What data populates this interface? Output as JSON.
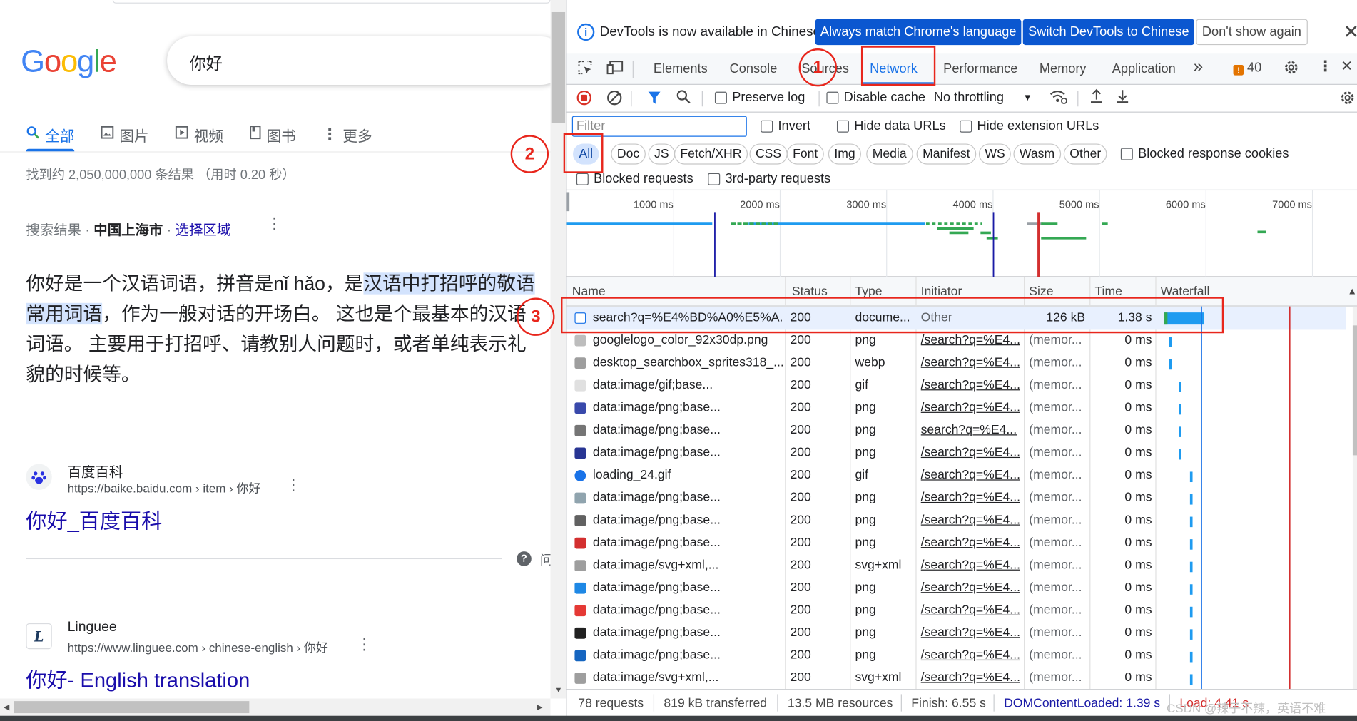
{
  "google": {
    "logo": "Google",
    "search_value": "你好",
    "tabs": [
      {
        "icon": "search-icon",
        "label": "全部",
        "active": true
      },
      {
        "icon": "image-icon",
        "label": "图片"
      },
      {
        "icon": "video-icon",
        "label": "视频"
      },
      {
        "icon": "book-icon",
        "label": "图书"
      },
      {
        "icon": "more-dots-icon",
        "label": "更多"
      }
    ],
    "stats": "找到约 2,050,000,000 条结果 （用时 0.20 秒）",
    "location_prefix": "搜索结果 · ",
    "location_city": "中国上海市",
    "location_sep": " · ",
    "location_link": "选择区域",
    "snippet_a": "你好是一个汉语词语，拼音是nǐ hǎo，是",
    "snippet_hl": "汉语中打招呼的敬语常用词语",
    "snippet_b": "，作为一般对话的开场白。 这也是个最基本的汉语词语。 主要用于打招呼、请教别人问题时，或者单纯表示礼貌的时候等。",
    "results": [
      {
        "site": "百度百科",
        "url": "https://baike.baidu.com › item › 你好",
        "title": "你好_百度百科"
      },
      {
        "site": "Linguee",
        "url": "https://www.linguee.com › chinese-english › 你好",
        "title": "你好- English translation"
      }
    ],
    "help_fragment": "问"
  },
  "devtools": {
    "info": {
      "text": "DevTools is now available in Chinese!",
      "btn_match": "Always match Chrome's language",
      "btn_switch": "Switch DevTools to Chinese",
      "btn_dont": "Don't show again"
    },
    "tabs": [
      "Elements",
      "Console",
      "Sources",
      "Network",
      "Performance",
      "Memory",
      "Application"
    ],
    "more_tabs": "»",
    "issues_count": "40",
    "toolbar": {
      "preserve_log": "Preserve log",
      "disable_cache": "Disable cache",
      "throttling": "No throttling"
    },
    "filter_placeholder": "Filter",
    "filter_checks": [
      "Invert",
      "Hide data URLs",
      "Hide extension URLs"
    ],
    "types": [
      "All",
      "Doc",
      "JS",
      "Fetch/XHR",
      "CSS",
      "Font",
      "Img",
      "Media",
      "Manifest",
      "WS",
      "Wasm",
      "Other"
    ],
    "blocked_cookies": "Blocked response cookies",
    "blocked_requests": "Blocked requests",
    "third_party": "3rd-party requests",
    "overview_ticks": [
      "1000 ms",
      "2000 ms",
      "3000 ms",
      "4000 ms",
      "5000 ms",
      "6000 ms",
      "7000 ms"
    ],
    "columns": [
      "Name",
      "Status",
      "Type",
      "Initiator",
      "Size",
      "Time",
      "Waterfall"
    ],
    "rows": [
      {
        "name": "search?q=%E4%BD%A0%E5%A...",
        "status": "200",
        "type": "docume...",
        "initiator": "Other",
        "size": "126 kB",
        "time": "1.38 s",
        "icon_color": "#1a73e8",
        "wf": 0.0
      },
      {
        "name": "googlelogo_color_92x30dp.png",
        "status": "200",
        "type": "png",
        "initiator": "/search?q=%E4...",
        "size": "(memor...",
        "time": "0 ms",
        "icon_color": "#bdbdbd",
        "wf": 0.06
      },
      {
        "name": "desktop_searchbox_sprites318_...",
        "status": "200",
        "type": "webp",
        "initiator": "/search?q=%E4...",
        "size": "(memor...",
        "time": "0 ms",
        "icon_color": "#9e9e9e",
        "wf": 0.06
      },
      {
        "name": "data:image/gif;base...",
        "status": "200",
        "type": "gif",
        "initiator": "/search?q=%E4...",
        "size": "(memor...",
        "time": "0 ms",
        "icon_color": "#e0e0e0",
        "wf": 0.17
      },
      {
        "name": "data:image/png;base...",
        "status": "200",
        "type": "png",
        "initiator": "/search?q=%E4...",
        "size": "(memor...",
        "time": "0 ms",
        "icon_color": "#3949ab",
        "wf": 0.17
      },
      {
        "name": "data:image/png;base...",
        "status": "200",
        "type": "png",
        "initiator": "search?q=%E4...",
        "size": "(memor...",
        "time": "0 ms",
        "icon_color": "#757575",
        "wf": 0.17
      },
      {
        "name": "data:image/png;base...",
        "status": "200",
        "type": "png",
        "initiator": "/search?q=%E4...",
        "size": "(memor...",
        "time": "0 ms",
        "icon_color": "#283593",
        "wf": 0.17
      },
      {
        "name": "loading_24.gif",
        "status": "200",
        "type": "gif",
        "initiator": "/search?q=%E4...",
        "size": "(memor...",
        "time": "0 ms",
        "icon_color": "#1a73e8",
        "wf": 0.3
      },
      {
        "name": "data:image/png;base...",
        "status": "200",
        "type": "png",
        "initiator": "/search?q=%E4...",
        "size": "(memor...",
        "time": "0 ms",
        "icon_color": "#90a4ae",
        "wf": 0.3
      },
      {
        "name": "data:image/png;base...",
        "status": "200",
        "type": "png",
        "initiator": "/search?q=%E4...",
        "size": "(memor...",
        "time": "0 ms",
        "icon_color": "#616161",
        "wf": 0.3
      },
      {
        "name": "data:image/png;base...",
        "status": "200",
        "type": "png",
        "initiator": "/search?q=%E4...",
        "size": "(memor...",
        "time": "0 ms",
        "icon_color": "#d32f2f",
        "wf": 0.3
      },
      {
        "name": "data:image/svg+xml,...",
        "status": "200",
        "type": "svg+xml",
        "initiator": "/search?q=%E4...",
        "size": "(memor...",
        "time": "0 ms",
        "icon_color": "#9e9e9e",
        "wf": 0.3
      },
      {
        "name": "data:image/png;base...",
        "status": "200",
        "type": "png",
        "initiator": "/search?q=%E4...",
        "size": "(memor...",
        "time": "0 ms",
        "icon_color": "#1e88e5",
        "wf": 0.3
      },
      {
        "name": "data:image/png;base...",
        "status": "200",
        "type": "png",
        "initiator": "/search?q=%E4...",
        "size": "(memor...",
        "time": "0 ms",
        "icon_color": "#e53935",
        "wf": 0.3
      },
      {
        "name": "data:image/png;base...",
        "status": "200",
        "type": "png",
        "initiator": "/search?q=%E4...",
        "size": "(memor...",
        "time": "0 ms",
        "icon_color": "#212121",
        "wf": 0.3
      },
      {
        "name": "data:image/png;base...",
        "status": "200",
        "type": "png",
        "initiator": "/search?q=%E4...",
        "size": "(memor...",
        "time": "0 ms",
        "icon_color": "#1565c0",
        "wf": 0.3
      },
      {
        "name": "data:image/svg+xml,...",
        "status": "200",
        "type": "svg+xml",
        "initiator": "/search?q=%E4...",
        "size": "(memor...",
        "time": "0 ms",
        "icon_color": "#9e9e9e",
        "wf": 0.3
      }
    ],
    "status": {
      "requests": "78 requests",
      "transferred": "819 kB transferred",
      "resources": "13.5 MB resources",
      "finish": "Finish: 6.55 s",
      "dcl": "DOMContentLoaded: 1.39 s",
      "load": "Load: 4.41 s"
    },
    "colors": {
      "accent": "#1a73e8",
      "dcl": "#1a1aa6",
      "load": "#d32f2f"
    }
  },
  "annotations": [
    "1",
    "2",
    "3"
  ],
  "watermark": "CSDN @辣子不辣，英语不难"
}
